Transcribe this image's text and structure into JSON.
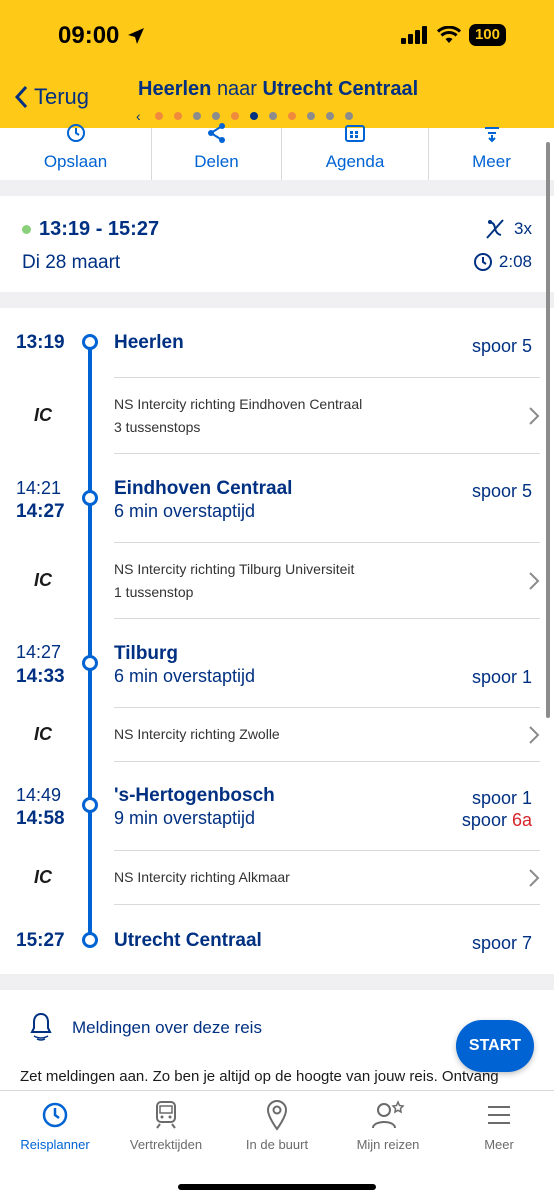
{
  "status_bar": {
    "time": "09:00",
    "battery": "100"
  },
  "header": {
    "back_label": "Terug",
    "title_from": "Heerlen",
    "title_connector": "naar",
    "title_to": "Utrecht Centraal",
    "page_dots": [
      "#f08a3c",
      "#f08a3c",
      "#8c8c8c",
      "#8c8c8c",
      "#f08a3c",
      "#003082",
      "#8c8c8c",
      "#f08a3c",
      "#8c8c8c",
      "#8c8c8c",
      "#8c8c8c"
    ]
  },
  "actions": [
    {
      "label": "Opslaan",
      "icon": "clock-icon"
    },
    {
      "label": "Delen",
      "icon": "share-icon"
    },
    {
      "label": "Agenda",
      "icon": "calendar-icon"
    },
    {
      "label": "Meer",
      "icon": "more-icon"
    }
  ],
  "summary": {
    "time_range": "13:19 - 15:27",
    "date": "Di 28 maart",
    "transfers": "3x",
    "duration": "2:08"
  },
  "stops": [
    {
      "arrival": "",
      "departure": "13:19",
      "station": "Heerlen",
      "transfer": "",
      "platform_label": "spoor 5",
      "platform_label_2": "",
      "platform_changed": ""
    },
    {
      "arrival": "14:21",
      "departure": "14:27",
      "station": "Eindhoven Centraal",
      "transfer": "6 min overstaptijd",
      "platform_label": "spoor 5",
      "platform_label_2": "",
      "platform_changed": ""
    },
    {
      "arrival": "14:27",
      "departure": "14:33",
      "station": "Tilburg",
      "transfer": "6 min overstaptijd",
      "platform_label": "spoor 1",
      "platform_label_2": "",
      "platform_changed": ""
    },
    {
      "arrival": "14:49",
      "departure": "14:58",
      "station": "'s-Hertogenbosch",
      "transfer": "9 min overstaptijd",
      "platform_label": "spoor 1",
      "platform_label_2": "spoor",
      "platform_changed": "6a"
    },
    {
      "arrival": "",
      "departure": "15:27",
      "station": "Utrecht Centraal",
      "transfer": "",
      "platform_label": "spoor 7",
      "platform_label_2": "",
      "platform_changed": ""
    }
  ],
  "legs": [
    {
      "type": "IC",
      "direction": "NS Intercity richting Eindhoven Centraal",
      "stops": "3 tussenstops"
    },
    {
      "type": "IC",
      "direction": "NS Intercity richting Tilburg Universiteit",
      "stops": "1 tussenstop"
    },
    {
      "type": "IC",
      "direction": "NS Intercity richting Zwolle",
      "stops": ""
    },
    {
      "type": "IC",
      "direction": "NS Intercity richting Alkmaar",
      "stops": ""
    }
  ],
  "notifications": {
    "title": "Meldingen over deze reis",
    "text": "Zet meldingen aan. Zo ben je altijd op de hoogte van jouw reis. Ontvang"
  },
  "start_label": "START",
  "tabs": [
    {
      "label": "Reisplanner",
      "icon": "clock-icon",
      "active": true
    },
    {
      "label": "Vertrektijden",
      "icon": "train-icon",
      "active": false
    },
    {
      "label": "In de buurt",
      "icon": "location-pin-icon",
      "active": false
    },
    {
      "label": "Mijn reizen",
      "icon": "user-star-icon",
      "active": false
    },
    {
      "label": "Meer",
      "icon": "menu-icon",
      "active": false
    }
  ],
  "colors": {
    "header_bg": "#ffc917",
    "ns_blue": "#003082",
    "accent_blue": "#0063d3",
    "changed_red": "#d6262b"
  }
}
